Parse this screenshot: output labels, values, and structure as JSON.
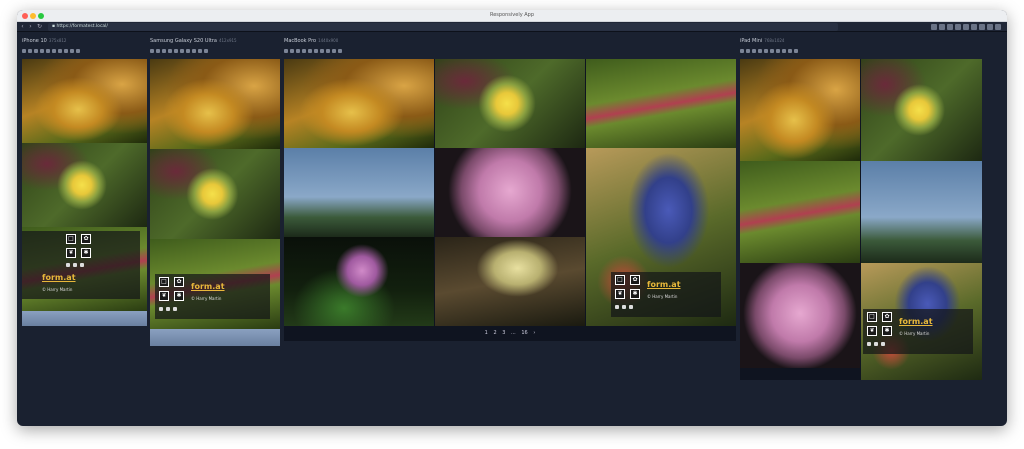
{
  "window": {
    "title": "Responsively App"
  },
  "toolbar": {
    "url": "https://formatest.local/"
  },
  "devices": [
    {
      "name": "iPhone 10",
      "size": "375x812"
    },
    {
      "name": "Samsung Galaxy S20 Ultra",
      "size": "412x915"
    },
    {
      "name": "MacBook Pro",
      "size": "1440x900"
    },
    {
      "name": "iPad Mini",
      "size": "768x1024"
    }
  ],
  "site": {
    "brand": "form.at",
    "copyright": "© Harry Martin"
  },
  "pagination": {
    "pages": [
      "1",
      "2",
      "3",
      "...",
      "16"
    ],
    "next": "›"
  },
  "icons": [
    "back-icon",
    "forward-icon",
    "reload-icon",
    "home-icon",
    "lock-icon"
  ],
  "colors": {
    "frame": "#1a2130",
    "brand": "#e8b83a",
    "titlebar": "#eceef1"
  }
}
